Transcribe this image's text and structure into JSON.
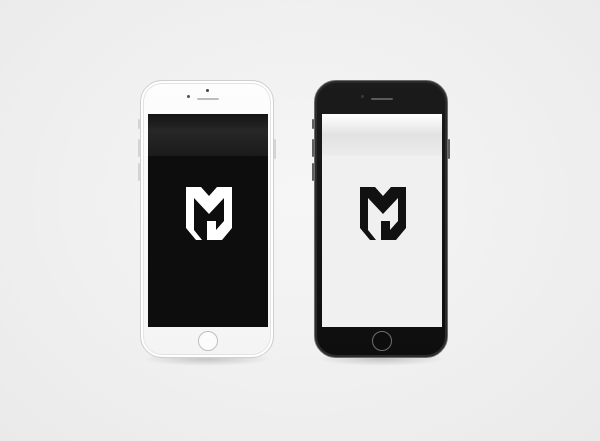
{
  "scene": {
    "background_color": "#f2f2f2"
  },
  "phones": [
    {
      "variant": "white",
      "body_color": "#f7f7f7",
      "screen_color": "#0d0d0d",
      "logo_icon": "mg-monogram-shield-icon",
      "logo_color": "#ffffff"
    },
    {
      "variant": "black",
      "body_color": "#141414",
      "screen_color": "#f0f0f0",
      "logo_icon": "mg-monogram-shield-icon",
      "logo_color": "#111111"
    }
  ]
}
